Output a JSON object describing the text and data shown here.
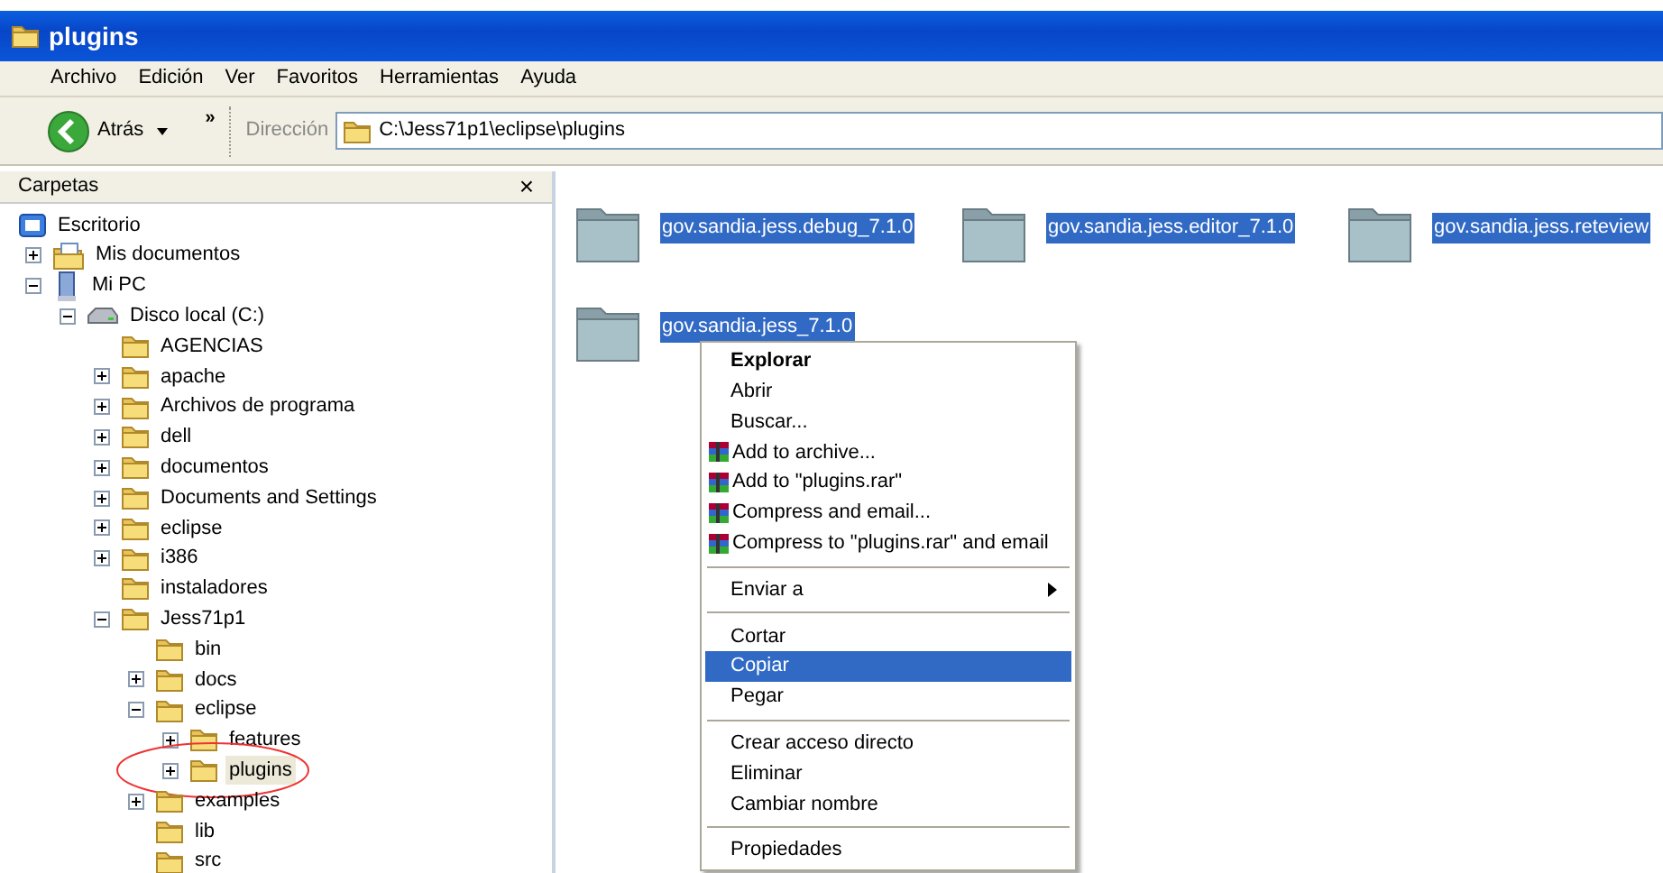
{
  "window": {
    "title": "plugins"
  },
  "menu": [
    "Archivo",
    "Edición",
    "Ver",
    "Favoritos",
    "Herramientas",
    "Ayuda"
  ],
  "toolbar": {
    "back": "Atrás",
    "chevron": "»",
    "address_label": "Dirección",
    "address": "C:\\Jess71p1\\eclipse\\plugins"
  },
  "folders_pane": {
    "title": "Carpetas",
    "close": "×",
    "tree": [
      {
        "label": "Escritorio",
        "kind": "desktop",
        "selected": false,
        "children": [
          {
            "label": "Mis documentos",
            "kind": "documents",
            "expanded": false,
            "selected": false
          },
          {
            "label": "Mi PC",
            "kind": "computer",
            "expanded": true,
            "selected": false,
            "children": [
              {
                "label": "Disco local (C:)",
                "kind": "drive",
                "expanded": true,
                "selected": false,
                "children": [
                  {
                    "label": "AGENCIAS",
                    "kind": "folder",
                    "selected": false
                  },
                  {
                    "label": "apache",
                    "kind": "folder",
                    "expanded": false,
                    "selected": false
                  },
                  {
                    "label": "Archivos de programa",
                    "kind": "folder",
                    "expanded": false,
                    "selected": false
                  },
                  {
                    "label": "dell",
                    "kind": "folder",
                    "expanded": false,
                    "selected": false
                  },
                  {
                    "label": "documentos",
                    "kind": "folder",
                    "expanded": false,
                    "selected": false
                  },
                  {
                    "label": "Documents and Settings",
                    "kind": "folder",
                    "expanded": false,
                    "selected": false
                  },
                  {
                    "label": "eclipse",
                    "kind": "folder",
                    "expanded": false,
                    "selected": false
                  },
                  {
                    "label": "i386",
                    "kind": "folder",
                    "expanded": false,
                    "selected": false
                  },
                  {
                    "label": "instaladores",
                    "kind": "folder",
                    "selected": false
                  },
                  {
                    "label": "Jess71p1",
                    "kind": "folder",
                    "expanded": true,
                    "selected": false,
                    "children": [
                      {
                        "label": "bin",
                        "kind": "folder",
                        "selected": false
                      },
                      {
                        "label": "docs",
                        "kind": "folder",
                        "expanded": false,
                        "selected": false
                      },
                      {
                        "label": "eclipse",
                        "kind": "folder",
                        "expanded": true,
                        "selected": false,
                        "children": [
                          {
                            "label": "features",
                            "kind": "folder",
                            "expanded": false,
                            "selected": false
                          },
                          {
                            "label": "plugins",
                            "kind": "folder",
                            "expanded": false,
                            "selected": true,
                            "circled": true
                          }
                        ]
                      },
                      {
                        "label": "examples",
                        "kind": "folder",
                        "expanded": false,
                        "selected": false
                      },
                      {
                        "label": "lib",
                        "kind": "folder",
                        "selected": false
                      },
                      {
                        "label": "src",
                        "kind": "folder",
                        "selected": false
                      }
                    ]
                  }
                ]
              }
            ]
          }
        ]
      }
    ]
  },
  "files": [
    {
      "name": "gov.sandia.jess.debug_7.1.0",
      "selected": true
    },
    {
      "name": "gov.sandia.jess.editor_7.1.0",
      "selected": true
    },
    {
      "name": "gov.sandia.jess.reteview",
      "selected": true
    },
    {
      "name": "gov.sandia.jess_7.1.0",
      "selected": true
    }
  ],
  "context_menu": [
    {
      "label": "Explorar",
      "kind": "default",
      "selected": false
    },
    {
      "label": "Abrir",
      "kind": "item",
      "selected": false
    },
    {
      "label": "Buscar...",
      "kind": "item",
      "selected": false
    },
    {
      "label": "Add to archive...",
      "kind": "rar",
      "selected": false
    },
    {
      "label": "Add to \"plugins.rar\"",
      "kind": "rar",
      "selected": false
    },
    {
      "label": "Compress and email...",
      "kind": "rar",
      "selected": false
    },
    {
      "label": "Compress to \"plugins.rar\" and email",
      "kind": "rar",
      "selected": false
    },
    {
      "kind": "separator"
    },
    {
      "label": "Enviar a",
      "kind": "submenu",
      "selected": false
    },
    {
      "kind": "separator"
    },
    {
      "label": "Cortar",
      "kind": "item",
      "selected": false
    },
    {
      "label": "Copiar",
      "kind": "item",
      "selected": true
    },
    {
      "label": "Pegar",
      "kind": "item",
      "selected": false
    },
    {
      "kind": "separator"
    },
    {
      "label": "Crear acceso directo",
      "kind": "item",
      "selected": false
    },
    {
      "label": "Eliminar",
      "kind": "item",
      "selected": false
    },
    {
      "label": "Cambiar nombre",
      "kind": "item",
      "selected": false
    },
    {
      "kind": "separator"
    },
    {
      "label": "Propiedades",
      "kind": "item",
      "selected": false
    }
  ]
}
